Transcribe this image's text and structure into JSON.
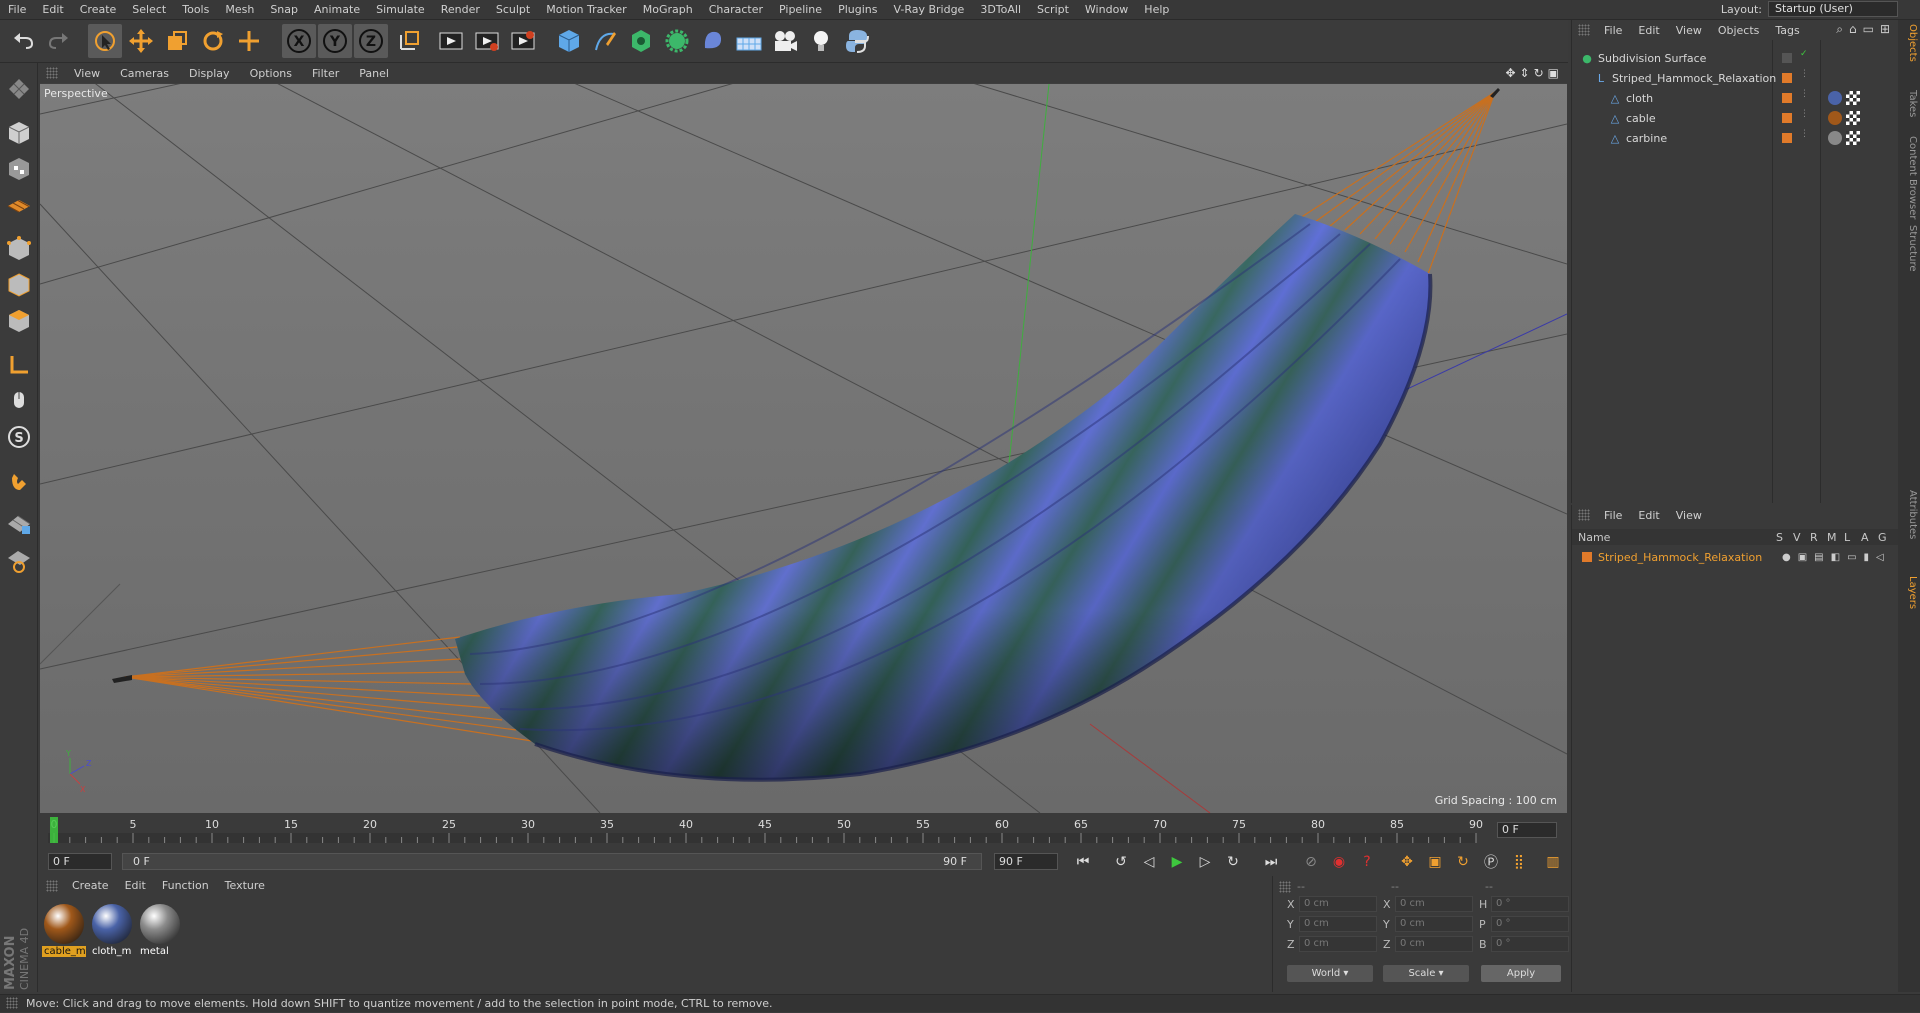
{
  "menu": [
    "File",
    "Edit",
    "Create",
    "Select",
    "Tools",
    "Mesh",
    "Snap",
    "Animate",
    "Simulate",
    "Render",
    "Sculpt",
    "Motion Tracker",
    "MoGraph",
    "Character",
    "Pipeline",
    "Plugins",
    "V-Ray Bridge",
    "3DToAll",
    "Script",
    "Window",
    "Help"
  ],
  "layout": {
    "label": "Layout:",
    "value": "Startup (User)"
  },
  "viewport": {
    "menu": [
      "View",
      "Cameras",
      "Display",
      "Options",
      "Filter",
      "Panel"
    ],
    "label": "Perspective",
    "grid_spacing": "Grid Spacing : 100 cm"
  },
  "timeline": {
    "ticks": [
      "0",
      "5",
      "10",
      "15",
      "20",
      "25",
      "30",
      "35",
      "40",
      "45",
      "50",
      "55",
      "60",
      "65",
      "70",
      "75",
      "80",
      "85",
      "90"
    ],
    "current_frame": "0 F"
  },
  "transport": {
    "start": "0 F",
    "range_start": "0 F",
    "range_end": "90 F",
    "end": "90 F"
  },
  "material_manager": {
    "menu": [
      "Create",
      "Edit",
      "Function",
      "Texture"
    ],
    "materials": [
      {
        "name": "cable_m",
        "color": "#a0581a"
      },
      {
        "name": "cloth_m",
        "color": "#4a63a8"
      },
      {
        "name": "metal",
        "color": "#8c8c8c"
      }
    ]
  },
  "coordinates": {
    "header": [
      "--",
      "--",
      "--"
    ],
    "rows": [
      {
        "a": "X",
        "av": "0 cm",
        "b": "X",
        "bv": "0 cm",
        "c": "H",
        "cv": "0 °"
      },
      {
        "a": "Y",
        "av": "0 cm",
        "b": "Y",
        "bv": "0 cm",
        "c": "P",
        "cv": "0 °"
      },
      {
        "a": "Z",
        "av": "0 cm",
        "b": "Z",
        "bv": "0 cm",
        "c": "B",
        "cv": "0 °"
      }
    ],
    "mode": "World",
    "type": "Scale",
    "apply": "Apply"
  },
  "object_manager": {
    "menu": [
      "File",
      "Edit",
      "View",
      "Objects",
      "Tags"
    ],
    "objects": [
      {
        "name": "Subdivision Surface",
        "level": 0
      },
      {
        "name": "Striped_Hammock_Relaxation",
        "level": 1
      },
      {
        "name": "cloth",
        "level": 2
      },
      {
        "name": "cable",
        "level": 2
      },
      {
        "name": "carbine",
        "level": 2
      }
    ]
  },
  "layer_manager": {
    "menu": [
      "File",
      "Edit",
      "View"
    ],
    "columns": [
      "Name",
      "S",
      "V",
      "R",
      "M",
      "L",
      "A",
      "G"
    ],
    "layers": [
      {
        "name": "Striped_Hammock_Relaxation",
        "color": "#e07a2a"
      }
    ]
  },
  "side_tabs": [
    "Objects",
    "Takes",
    "Content Browser",
    "Structure",
    "Attributes",
    "Layers"
  ],
  "brand": {
    "maker": "MAXON",
    "product": "CINEMA 4D"
  },
  "status": "Move: Click and drag to move elements. Hold down SHIFT to quantize movement / add to the selection in point mode, CTRL to remove."
}
